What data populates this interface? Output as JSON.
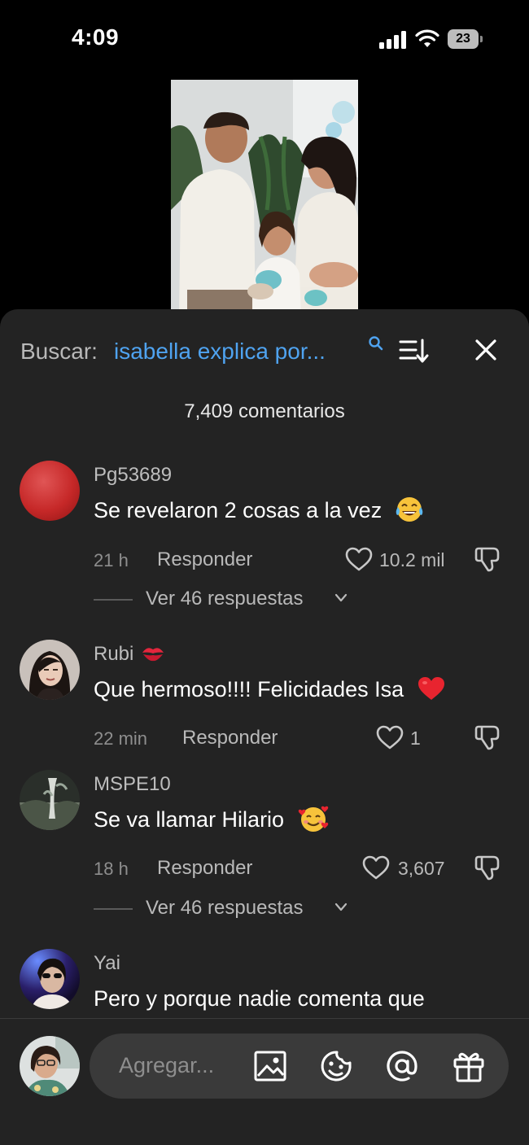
{
  "status_bar": {
    "time": "4:09",
    "battery": "23"
  },
  "search": {
    "prefix": "Buscar:",
    "query": "isabella explica por..."
  },
  "comments_count": "7,409 comentarios",
  "comments": [
    {
      "username": "Pg53689",
      "text": "Se revelaron 2 cosas a la vez",
      "emoji": "tears-of-joy",
      "time": "21 h",
      "reply": "Responder",
      "likes": "10.2 mil",
      "view_replies": "Ver 46 respuestas"
    },
    {
      "username": "Rubi",
      "username_emoji": "kiss-mark",
      "text": "Que hermoso!!!! Felicidades Isa",
      "emoji": "red-heart",
      "time": "22 min",
      "reply": "Responder",
      "likes": "1"
    },
    {
      "username": "MSPE10",
      "text": "Se va llamar Hilario",
      "emoji": "smiling-face-with-hearts",
      "time": "18 h",
      "reply": "Responder",
      "likes": "3,607",
      "view_replies": "Ver 46 respuestas"
    },
    {
      "username": "Yai",
      "text": "Pero y porque nadie comenta que"
    }
  ],
  "input": {
    "placeholder": "Agregar..."
  },
  "colors": {
    "sheet": "#232323",
    "accent_link": "#4fa3f0",
    "heart_red": "#e8242f"
  }
}
